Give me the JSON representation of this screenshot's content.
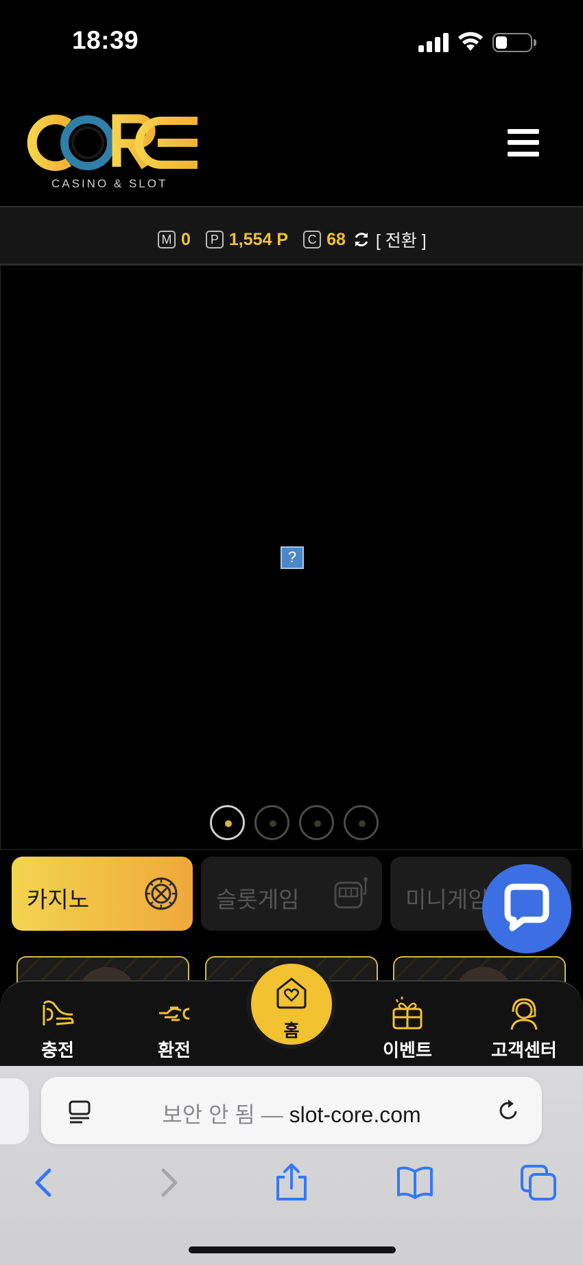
{
  "status_bar": {
    "time": "18:39"
  },
  "header": {
    "logo_text": "CORE",
    "logo_subtitle": "CASINO & SLOT"
  },
  "points": {
    "money_icon": "M",
    "money_value": "0",
    "point_icon": "P",
    "point_value": "1,554 P",
    "coin_icon": "C",
    "coin_value": "68",
    "switch_label": "[ 전환 ]"
  },
  "banner": {
    "broken_image_glyph": "?",
    "slide_count": 4,
    "active_slide": 1
  },
  "categories": [
    {
      "label": "카지노",
      "icon": "roulette-icon",
      "active": true
    },
    {
      "label": "슬롯게임",
      "icon": "slot-machine-icon",
      "active": false
    },
    {
      "label": "미니게임",
      "icon": "",
      "active": false
    }
  ],
  "bottom_nav": {
    "charge": "충전",
    "exchange": "환전",
    "home": "홈",
    "event": "이벤트",
    "support": "고객센터"
  },
  "browser": {
    "insecure_label": "보안 안 됨 —",
    "domain": "slot-core.com"
  },
  "colors": {
    "accent_gold": "#f2c230",
    "chat_blue": "#3c6fe3",
    "ios_blue": "#3478f6"
  }
}
